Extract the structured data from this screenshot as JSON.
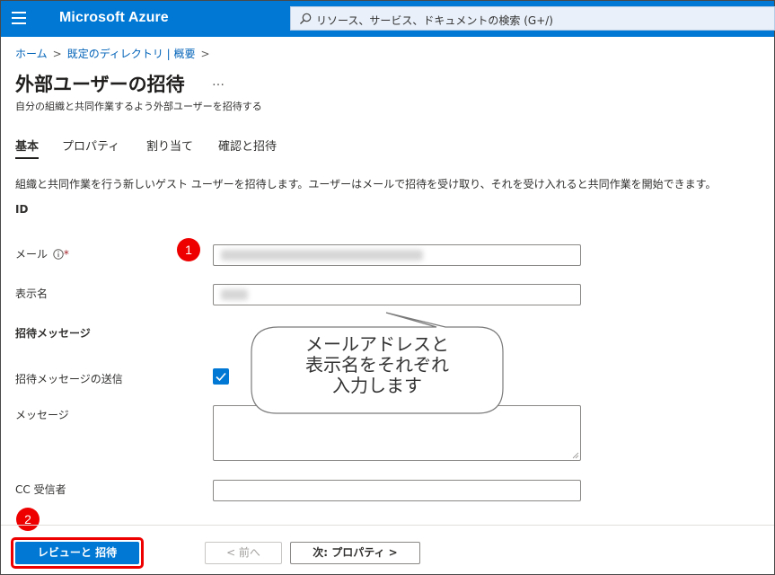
{
  "topbar": {
    "brand": "Microsoft Azure",
    "search_placeholder": "リソース、サービス、ドキュメントの検索 (G+/)",
    "menu_icon": "hamburger-icon",
    "search_icon": "search-icon",
    "accent": "#0078d4"
  },
  "breadcrumb": {
    "home": "ホーム",
    "directory": "既定のディレクトリ | 概要"
  },
  "page": {
    "title": "外部ユーザーの招待",
    "more": "…",
    "subtitle": "自分の組織と共同作業するよう外部ユーザーを招待する"
  },
  "tabs": [
    "基本",
    "プロパティ",
    "割り当て",
    "確認と招待"
  ],
  "description": "組織と共同作業を行う新しいゲスト ユーザーを招待します。ユーザーはメールで招待を受け取り、それを受け入れると共同作業を開始できます。",
  "form": {
    "section_id": "ID",
    "email_label": "メール",
    "email_required": "*",
    "display_name_label": "表示名",
    "invite_section": "招待メッセージ",
    "send_invite_label": "招待メッセージの送信",
    "send_invite_checked": true,
    "message_label": "メッセージ",
    "cc_label": "CC 受信者"
  },
  "annotations": {
    "badge1": "1",
    "badge2": "2",
    "callout": "メールアドレスと\n表示名をそれぞれ\n入力します",
    "highlight_color": "#ee0000"
  },
  "footer": {
    "review_button": "レビューと 招待",
    "prev_button": "< 前へ",
    "next_button": "次: プロパティ >"
  }
}
